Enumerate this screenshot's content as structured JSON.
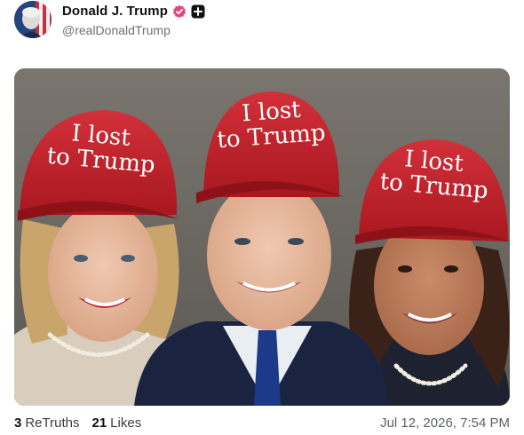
{
  "post": {
    "author_name": "Donald J. Trump",
    "handle": "@realDonaldTrump",
    "image": {
      "hat_line1": "I lost",
      "hat_line2": "to Trump"
    },
    "stats": {
      "retruths_count": "3",
      "retruths_label": "ReTruths",
      "likes_count": "21",
      "likes_label": "Likes"
    },
    "timestamp": "Jul 12, 2026, 7:54 PM"
  },
  "colors": {
    "hat_red": "#c4202b",
    "verified_pink": "#e4457e",
    "text_muted": "#6b6f76"
  },
  "icons": {
    "verified": "verified-badge-icon",
    "plus": "plus-badge-icon"
  }
}
